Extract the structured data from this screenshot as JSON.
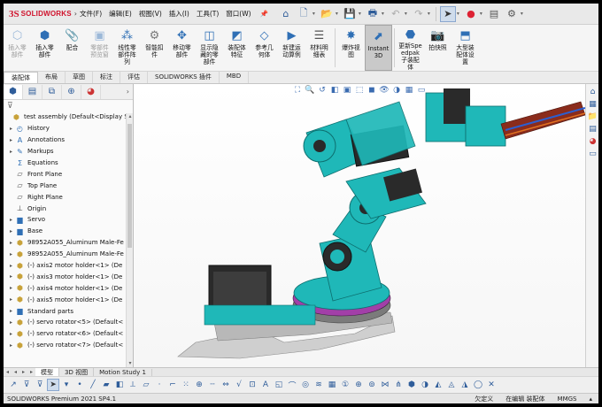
{
  "app": {
    "logo_mark": "3S",
    "logo_text": "SOLIDWORKS"
  },
  "menu": [
    "文件(F)",
    "编辑(E)",
    "视图(V)",
    "插入(I)",
    "工具(T)",
    "窗口(W)"
  ],
  "ribbon": [
    {
      "label": "插入零部件",
      "icon": "insert-component-icon",
      "dim": true
    },
    {
      "label": "插入零部件",
      "icon": "insert-part-icon",
      "dim": false
    },
    {
      "label": "配合",
      "icon": "mate-icon",
      "dim": false
    },
    {
      "label": "零部件预览窗",
      "icon": "component-preview-icon",
      "dim": true
    },
    {
      "label": "线性零部件阵列",
      "icon": "linear-pattern-icon",
      "dim": false
    },
    {
      "label": "智能扣件",
      "icon": "smart-fastener-icon",
      "dim": false
    },
    {
      "label": "移动零部件",
      "icon": "move-component-icon",
      "dim": false
    },
    {
      "label": "显示隐藏的零部件",
      "icon": "show-hidden-icon",
      "dim": false
    },
    {
      "label": "装配体特征",
      "icon": "assembly-feature-icon",
      "dim": false
    },
    {
      "label": "参考几何体",
      "icon": "reference-geometry-icon",
      "dim": false
    },
    {
      "label": "新建运动算例",
      "icon": "new-motion-study-icon",
      "dim": false
    },
    {
      "label": "材料明细表",
      "icon": "bom-icon",
      "dim": false
    },
    {
      "label": "爆炸视图",
      "icon": "exploded-view-icon",
      "dim": false
    },
    {
      "label": "Instant3D",
      "icon": "instant3d-icon",
      "dim": false,
      "active": true
    },
    {
      "label": "更新Speedpak子装配体",
      "icon": "speedpak-icon",
      "dim": false
    },
    {
      "label": "拍快照",
      "icon": "snapshot-icon",
      "dim": false
    },
    {
      "label": "大型装配体设置",
      "icon": "large-assembly-icon",
      "dim": false
    }
  ],
  "cm_tabs": [
    "装配体",
    "布局",
    "草图",
    "标注",
    "评估",
    "SOLIDWORKS 插件",
    "MBD"
  ],
  "tree": [
    {
      "label": "test assembly  (Default<Display St",
      "icon": "assembly-icon",
      "toggle": "",
      "indent": 0
    },
    {
      "label": "History",
      "icon": "history-icon",
      "toggle": "▸",
      "indent": 1
    },
    {
      "label": "Annotations",
      "icon": "annotations-icon",
      "toggle": "▸",
      "indent": 1
    },
    {
      "label": "Markups",
      "icon": "markups-icon",
      "toggle": "▸",
      "indent": 1
    },
    {
      "label": "Equations",
      "icon": "equations-icon",
      "toggle": "",
      "indent": 1
    },
    {
      "label": "Front Plane",
      "icon": "plane-icon",
      "toggle": "",
      "indent": 1
    },
    {
      "label": "Top Plane",
      "icon": "plane-icon",
      "toggle": "",
      "indent": 1
    },
    {
      "label": "Right Plane",
      "icon": "plane-icon",
      "toggle": "",
      "indent": 1
    },
    {
      "label": "Origin",
      "icon": "origin-icon",
      "toggle": "",
      "indent": 1
    },
    {
      "label": "Servo",
      "icon": "folder-icon",
      "toggle": "▸",
      "indent": 1
    },
    {
      "label": "Base",
      "icon": "folder-icon",
      "toggle": "▸",
      "indent": 1
    },
    {
      "label": "98952A055_Aluminum Male-Fe",
      "icon": "part-icon",
      "toggle": "▸",
      "indent": 1
    },
    {
      "label": "98952A055_Aluminum Male-Fe",
      "icon": "part-icon",
      "toggle": "▸",
      "indent": 1
    },
    {
      "label": "(-) axis2 motor holder<1> (De",
      "icon": "part-icon",
      "toggle": "▸",
      "indent": 1
    },
    {
      "label": "(-) axis3 motor holder<1> (De",
      "icon": "part-icon",
      "toggle": "▸",
      "indent": 1
    },
    {
      "label": "(-) axis4 motor holder<1> (De",
      "icon": "part-icon",
      "toggle": "▸",
      "indent": 1
    },
    {
      "label": "(-) axis5 motor holder<1> (De",
      "icon": "part-icon",
      "toggle": "▸",
      "indent": 1
    },
    {
      "label": "Standard parts",
      "icon": "folder-icon",
      "toggle": "▸",
      "indent": 1
    },
    {
      "label": "(-) servo rotator<5> (Default<",
      "icon": "part-icon",
      "toggle": "▸",
      "indent": 1
    },
    {
      "label": "(-) servo rotator<6> (Default<",
      "icon": "part-icon",
      "toggle": "▸",
      "indent": 1
    },
    {
      "label": "(-) servo rotator<7> (Default<",
      "icon": "part-icon",
      "toggle": "▸",
      "indent": 1
    }
  ],
  "bottom_tabs": [
    "模型",
    "3D 视图",
    "Motion Study 1"
  ],
  "status": {
    "left": "SOLIDWORKS Premium 2021 SP4.1",
    "undefined": "欠定义",
    "editing": "在编辑 装配体",
    "units": "MMGS"
  },
  "colors": {
    "accent": "#1fb8b8",
    "brand": "#d0112b"
  }
}
